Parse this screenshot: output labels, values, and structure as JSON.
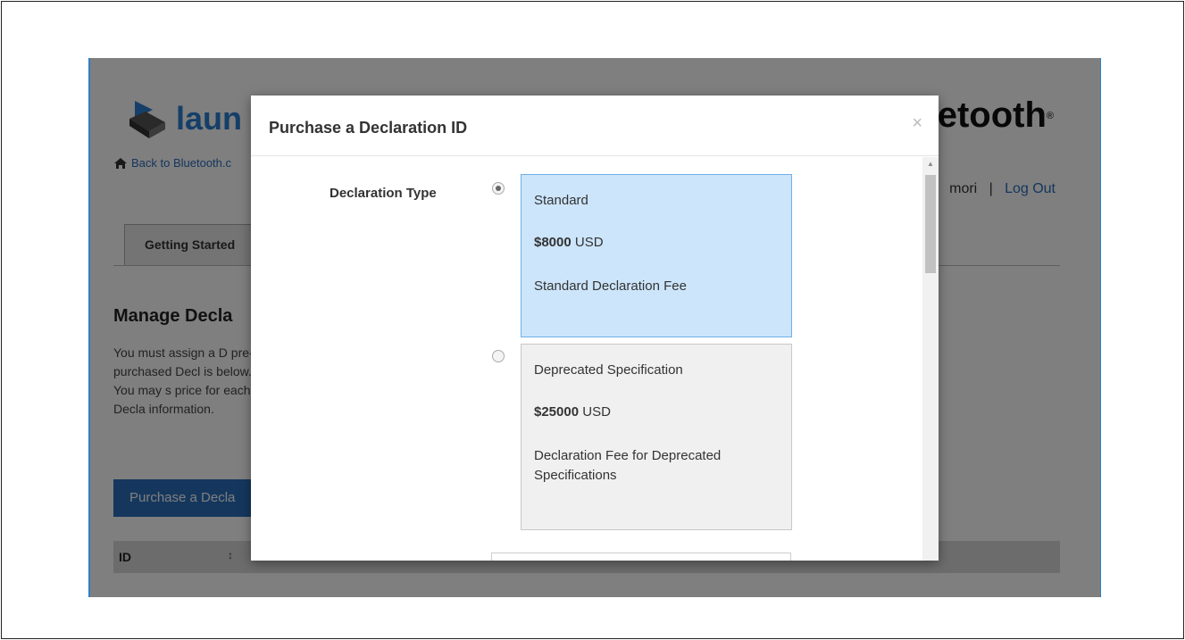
{
  "background_page": {
    "logo_text": "laun",
    "bluetooth_logo_text": "Bluetooth",
    "back_link_text": "Back to Bluetooth.c",
    "user_name_fragment": "mori",
    "separator": "|",
    "logout_label": "Log Out",
    "tab_getting_started": "Getting Started",
    "manage_title": "Manage Decla",
    "manage_text": "You must assign a D pre-purchased Decl is below. You may s price for each Decla information.",
    "purchase_button_label": "Purchase a Decla",
    "table_header_id": "ID",
    "table_sort_icon": "↕"
  },
  "modal": {
    "title": "Purchase a Declaration ID",
    "close_glyph": "×",
    "field_label": "Declaration Type",
    "options": [
      {
        "selected": true,
        "name": "Standard",
        "price": "$8000",
        "currency": "USD",
        "description": "Standard Declaration Fee"
      },
      {
        "selected": false,
        "name": "Deprecated Specification",
        "price": "$25000",
        "currency": "USD",
        "description": "Declaration Fee for Deprecated Specifications"
      }
    ]
  },
  "colors": {
    "link_blue": "#2a6ebd",
    "selected_card": "#cce5fb",
    "normal_card": "#f0f0f0"
  }
}
